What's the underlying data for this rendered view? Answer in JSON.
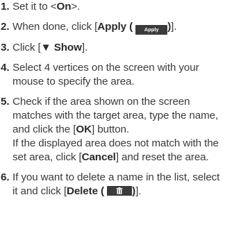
{
  "steps": [
    {
      "num": "1.",
      "pre": "Set it to <",
      "bold": "On",
      "post": ">."
    },
    {
      "num": "2.",
      "pre": "When done, click [",
      "bold": "Apply (",
      "button_text": "Apply",
      "bold_after": ")",
      "post": "]."
    },
    {
      "num": "3.",
      "pre": "Click [",
      "bold": "▼ Show",
      "post": "]."
    },
    {
      "num": "4.",
      "text": "Select 4 vertices on the screen with your mouse to specify the area."
    },
    {
      "num": "5.",
      "pre": "Check if the area shown on the screen matches with the target area, type the name, and click the [",
      "bold": "OK",
      "post": "] button.",
      "line2_pre": "If the displayed area does not match with the set area, click [",
      "line2_bold": "Cancel",
      "line2_post": "] and reset the area."
    },
    {
      "num": "6.",
      "pre": "If you want to delete a name in the list, select it and click [",
      "bold": "Delete (",
      "bold_after": ")",
      "post": "].",
      "button_icon": "trash-icon"
    }
  ],
  "colors": {
    "text": "#3a3a3a",
    "button_bg": "#3b3b3b",
    "button_fg": "#ffffff"
  }
}
